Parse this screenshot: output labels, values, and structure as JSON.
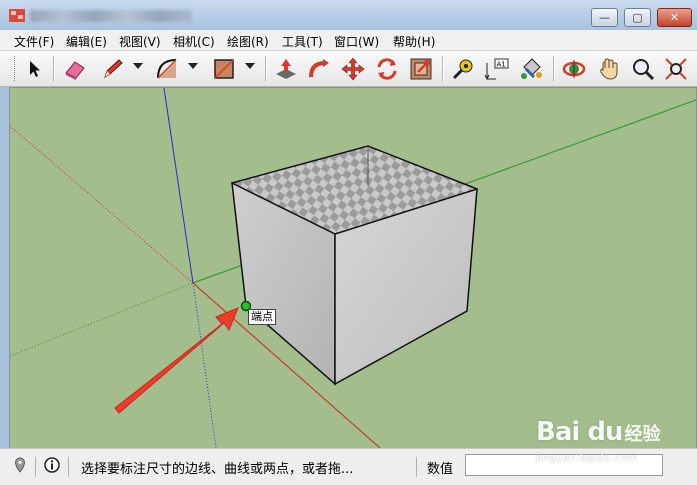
{
  "window": {
    "minimize_symbol": "—",
    "maximize_symbol": "▢",
    "close_symbol": "✕"
  },
  "menu": [
    {
      "label": "文件(F)"
    },
    {
      "label": "编辑(E)"
    },
    {
      "label": "视图(V)"
    },
    {
      "label": "相机(C)"
    },
    {
      "label": "绘图(R)"
    },
    {
      "label": "工具(T)"
    },
    {
      "label": "窗口(W)"
    },
    {
      "label": "帮助(H)"
    }
  ],
  "toolbar": {
    "tools": [
      "select-arrow-icon",
      "eraser-icon",
      "pencil-line-icon",
      "arc-icon",
      "rectangle-icon",
      "push-pull-icon",
      "follow-me-icon",
      "move-icon",
      "rotate-icon",
      "offset-icon",
      "tape-measure-icon",
      "dimension-icon",
      "paint-bucket-icon",
      "orbit-icon",
      "pan-hand-icon",
      "zoom-icon",
      "zoom-extents-icon"
    ],
    "dimension_icon_text": "A1"
  },
  "viewport": {
    "background_color": "#a3bd8d",
    "axis_colors": {
      "red": "#d0231a",
      "green": "#1f9a1f",
      "blue": "#2a2ad0"
    },
    "inference_tooltip": "端点"
  },
  "status": {
    "message": "选择要标注尺寸的边线、曲线或两点，或者拖...",
    "measurements_label": "数值",
    "measurements_value": ""
  },
  "watermark": {
    "logo": "Bai du",
    "subtitle": "经验",
    "url": "jingyan.baidu.com"
  }
}
